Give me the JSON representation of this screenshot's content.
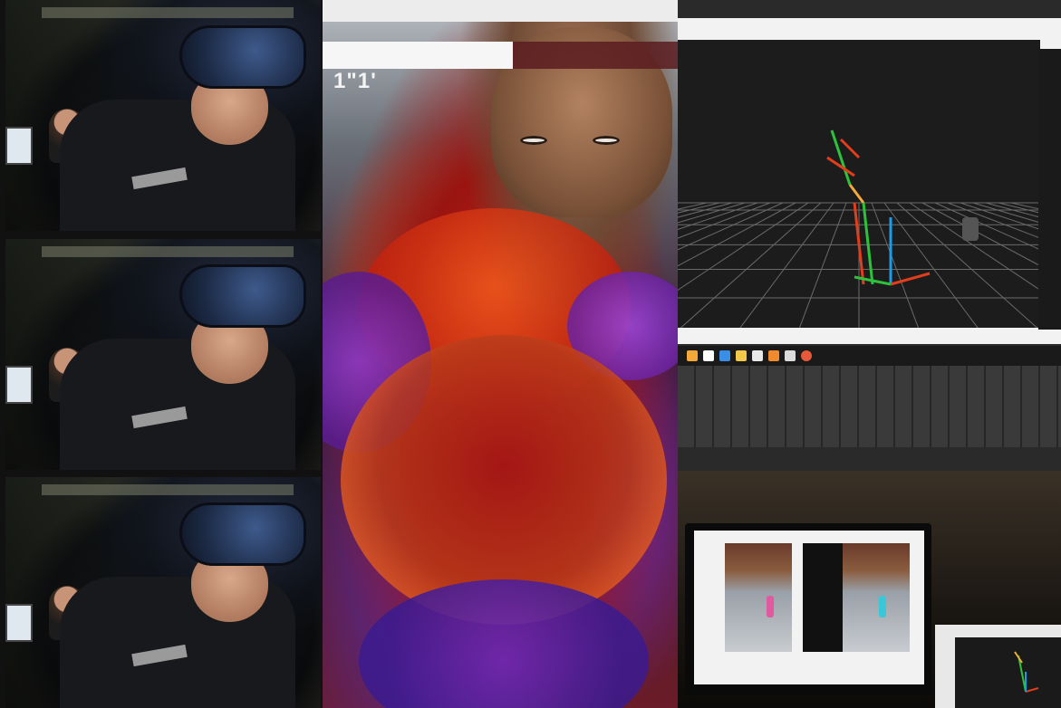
{
  "vr_view": {
    "timer_text": "1\"1'"
  },
  "colors": {
    "vr_hud_bg": "#f6f6f6",
    "viewport_bg": "#1c1c1c",
    "grid_line": "#6a6a6a",
    "axis_red": "#e33d1c",
    "axis_green": "#2cc33a",
    "axis_blue": "#1e9be6"
  },
  "icons": [
    "taskbar-app-icon"
  ]
}
